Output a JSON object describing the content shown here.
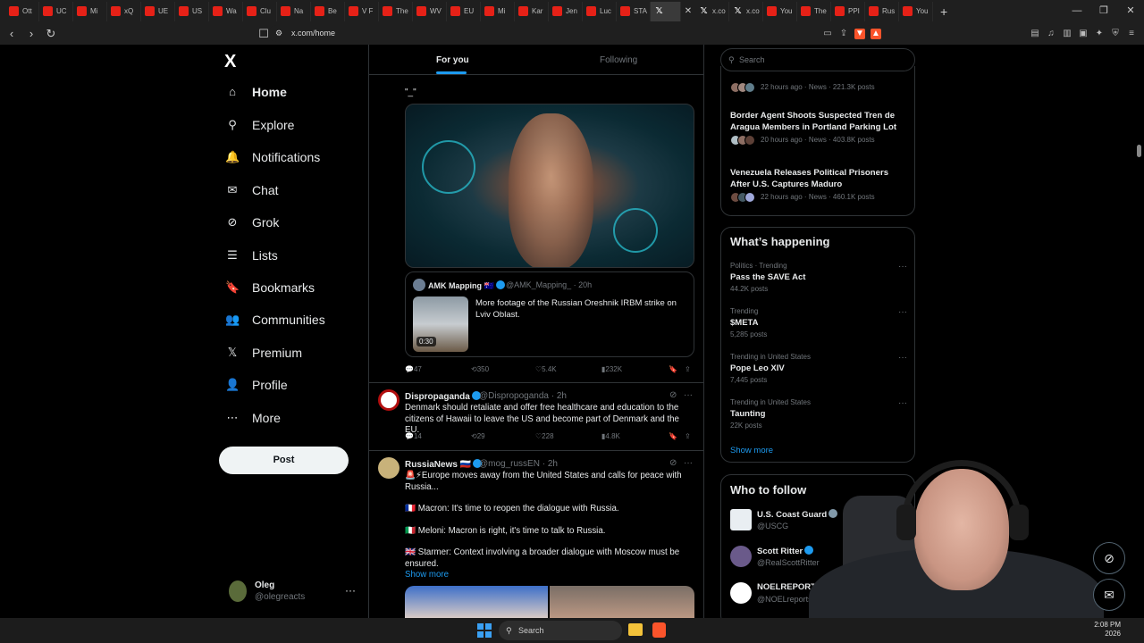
{
  "browser": {
    "tabs": [
      {
        "label": "Ott",
        "kind": "yt"
      },
      {
        "label": "UC",
        "kind": "yt"
      },
      {
        "label": "Mi",
        "kind": "yt"
      },
      {
        "label": "xQ",
        "kind": "yt"
      },
      {
        "label": "UE",
        "kind": "yt"
      },
      {
        "label": "US",
        "kind": "yt"
      },
      {
        "label": "Wa",
        "kind": "yt"
      },
      {
        "label": "Clu",
        "kind": "yt"
      },
      {
        "label": "Na",
        "kind": "yt"
      },
      {
        "label": "Be",
        "kind": "yt"
      },
      {
        "label": "V F",
        "kind": "yt"
      },
      {
        "label": "The",
        "kind": "yt"
      },
      {
        "label": "WV",
        "kind": "yt"
      },
      {
        "label": "EU",
        "kind": "yt"
      },
      {
        "label": "Mi",
        "kind": "yt"
      },
      {
        "label": "Kar",
        "kind": "yt"
      },
      {
        "label": "Jen",
        "kind": "yt"
      },
      {
        "label": "Luc",
        "kind": "yt"
      },
      {
        "label": "STA",
        "kind": "yt"
      },
      {
        "label": "",
        "kind": "x",
        "active": true
      },
      {
        "label": "x.co",
        "kind": "x"
      },
      {
        "label": "x.co",
        "kind": "x"
      },
      {
        "label": "You",
        "kind": "yt"
      },
      {
        "label": "The",
        "kind": "yt"
      },
      {
        "label": "PPI",
        "kind": "yt"
      },
      {
        "label": "Rus",
        "kind": "yt"
      },
      {
        "label": "You",
        "kind": "yt"
      }
    ],
    "url": "x.com/home"
  },
  "nav": {
    "logo": "X",
    "items": [
      {
        "label": "Home",
        "icon": "home-icon",
        "glyph": "⌂"
      },
      {
        "label": "Explore",
        "icon": "search-icon",
        "glyph": "⚲"
      },
      {
        "label": "Notifications",
        "icon": "bell-icon",
        "glyph": "🔔"
      },
      {
        "label": "Chat",
        "icon": "mail-icon",
        "glyph": "✉"
      },
      {
        "label": "Grok",
        "icon": "grok-icon",
        "glyph": "⊘"
      },
      {
        "label": "Lists",
        "icon": "list-icon",
        "glyph": "☰"
      },
      {
        "label": "Bookmarks",
        "icon": "bookmark-icon",
        "glyph": "🔖"
      },
      {
        "label": "Communities",
        "icon": "communities-icon",
        "glyph": "👥"
      },
      {
        "label": "Premium",
        "icon": "x-premium-icon",
        "glyph": "𝕏"
      },
      {
        "label": "Profile",
        "icon": "profile-icon",
        "glyph": "👤"
      },
      {
        "label": "More",
        "icon": "more-icon",
        "glyph": "⋯"
      }
    ],
    "post_button": "Post",
    "account": {
      "name": "Oleg",
      "handle": "@olegreacts"
    }
  },
  "feed": {
    "tabs": [
      "For you",
      "Following"
    ],
    "quote_mark": "\"_\"",
    "quoted": {
      "name": "AMK Mapping",
      "meta": "@AMK_Mapping_ · 20h",
      "text": "More footage of the Russian Oreshnik IRBM strike on Lviv Oblast.",
      "duration": "0:30"
    },
    "actions1": {
      "replies": "47",
      "reposts": "350",
      "likes": "5.4K",
      "views": "232K"
    },
    "post2": {
      "name": "Dispropaganda",
      "meta": "@Dispropoganda · 2h",
      "text": "Denmark should retaliate and offer free healthcare and education to the citizens of Hawaii to leave the US and become part of Denmark and the EU.",
      "replies": "14",
      "reposts": "29",
      "likes": "228",
      "views": "4.8K"
    },
    "post3": {
      "name": "RussiaNews",
      "flag": "🇷🇺",
      "meta": "@mog_russEN · 2h",
      "lines": [
        "🚨⚡Europe moves away from the United States and calls for peace with Russia...",
        "🇫🇷 Macron: It's time to reopen the dialogue with Russia.",
        "🇮🇹 Meloni: Macron is right, it's time to talk to Russia.",
        "🇬🇧 Starmer: Context involving a broader dialogue with Moscow must be ensured."
      ],
      "show_more": "Show more"
    }
  },
  "sidebar": {
    "search_placeholder": "Search",
    "news": [
      {
        "title": "",
        "meta": "22 hours ago · News · 221.3K posts"
      },
      {
        "title": "Border Agent Shoots Suspected Tren de Aragua Members in Portland Parking Lot",
        "meta": "20 hours ago · News · 403.8K posts"
      },
      {
        "title": "Venezuela Releases Political Prisoners After U.S. Captures Maduro",
        "meta": "22 hours ago · News · 460.1K posts"
      }
    ],
    "happening_title": "What’s happening",
    "trends": [
      {
        "context": "Politics · Trending",
        "name": "Pass the SAVE Act",
        "posts": "44.2K posts"
      },
      {
        "context": "Trending",
        "name": "$META",
        "posts": "5,285 posts"
      },
      {
        "context": "Trending in United States",
        "name": "Pope Leo XIV",
        "posts": "7,445 posts"
      },
      {
        "context": "Trending in United States",
        "name": "Taunting",
        "posts": "22K posts"
      }
    ],
    "show_more": "Show more",
    "who_to_follow_title": "Who to follow",
    "follow": [
      {
        "name": "U.S. Coast Guard",
        "handle": "@USCG"
      },
      {
        "name": "Scott Ritter",
        "handle": "@RealScottRitter"
      },
      {
        "name": "NOELREPORTS",
        "handle": "@NOELreports"
      }
    ]
  },
  "taskbar": {
    "search": "Search",
    "time": "2:08 PM",
    "date": "2026"
  }
}
